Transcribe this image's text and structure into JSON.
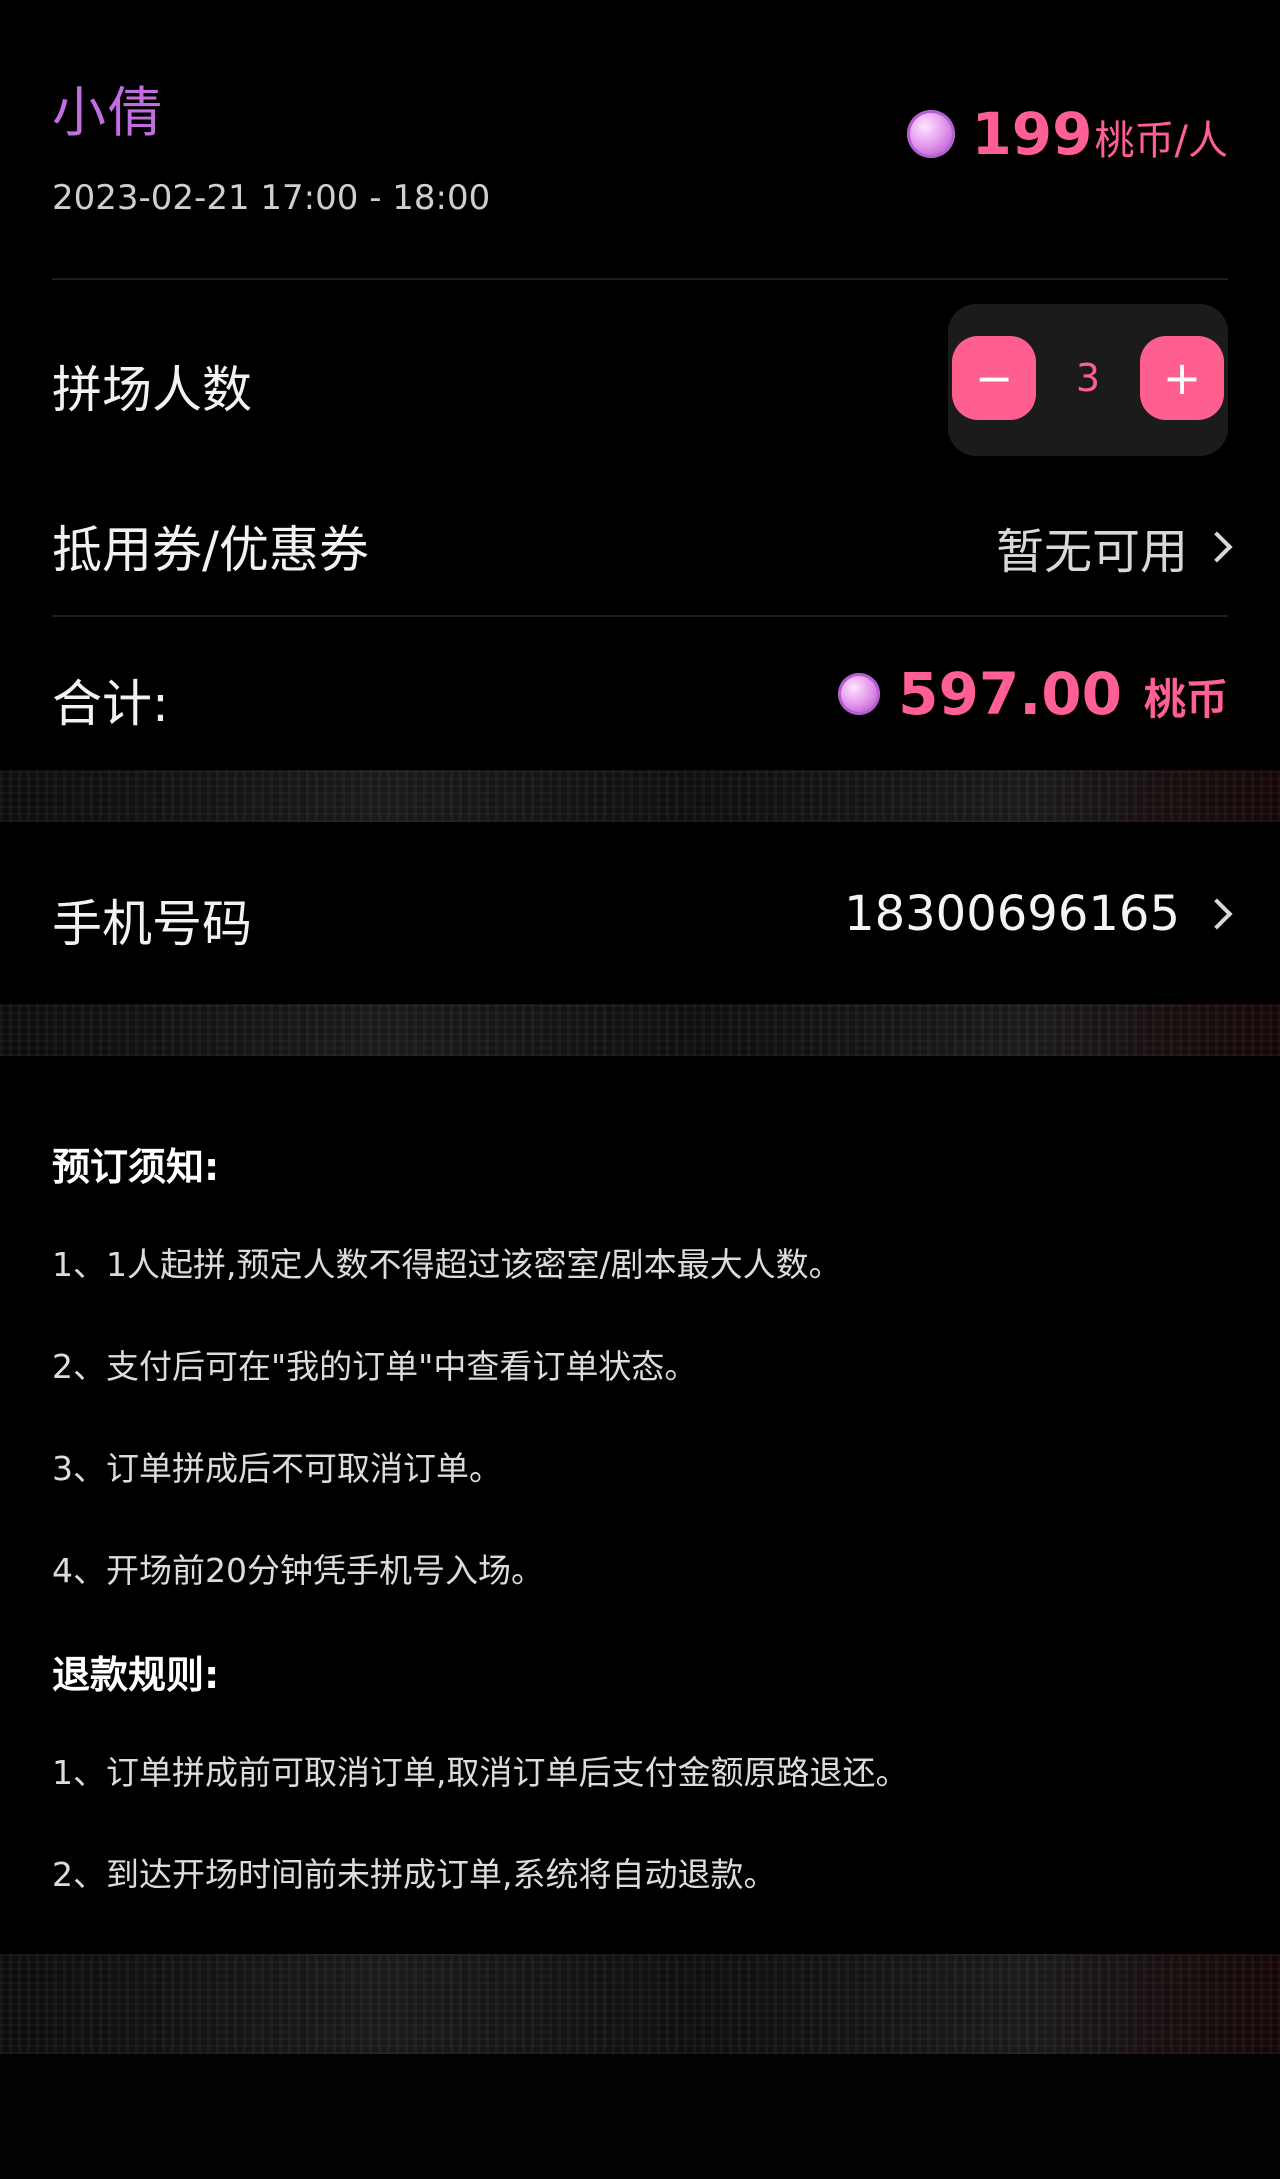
{
  "session": {
    "host": "小倩",
    "time_range": "2023-02-21 17:00 - 18:00",
    "price": "199",
    "price_unit": "桃币/人"
  },
  "players": {
    "label": "拼场人数",
    "minus": "−",
    "count": "3",
    "plus": "+"
  },
  "coupon": {
    "label": "抵用券/优惠券",
    "value": "暂无可用"
  },
  "total": {
    "label": "合计:",
    "amount": "597.00",
    "unit": "桃币"
  },
  "phone": {
    "label": "手机号码",
    "value": "18300696165"
  },
  "booking_notice": {
    "title": "预订须知:",
    "items": [
      "1、1人起拼,预定人数不得超过该密室/剧本最大人数。",
      "2、支付后可在\"我的订单\"中查看订单状态。",
      "3、订单拼成后不可取消订单。",
      "4、开场前20分钟凭手机号入场。"
    ]
  },
  "refund_rules": {
    "title": "退款规则:",
    "items": [
      "1、订单拼成前可取消订单,取消订单后支付金额原路退还。",
      "2、到达开场时间前未拼成订单,系统将自动退款。"
    ]
  },
  "colors": {
    "accent_pink": "#ff5f96",
    "host_purple": "#c36ee0",
    "background": "#000000"
  },
  "icons": [
    "peach-coin-icon",
    "chevron-right-icon",
    "minus-icon",
    "plus-icon"
  ]
}
